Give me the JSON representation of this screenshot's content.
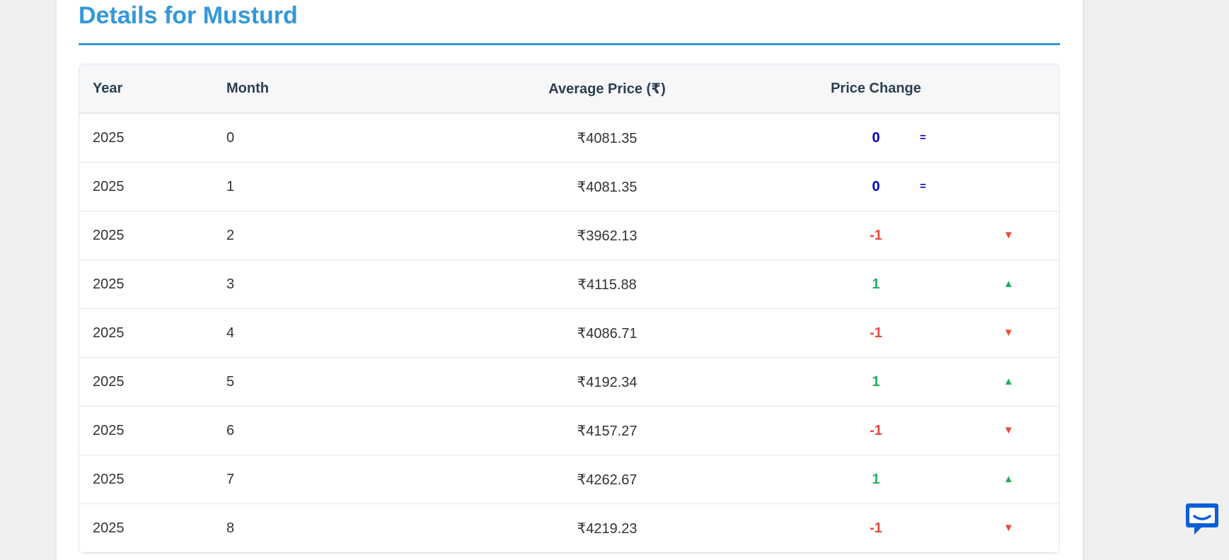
{
  "page": {
    "title": "Details for Musturd"
  },
  "table": {
    "headers": {
      "year": "Year",
      "month": "Month",
      "avg_price": "Average Price (₹)",
      "price_change": "Price Change"
    },
    "rows": [
      {
        "year": "2025",
        "month": "0",
        "price": "₹4081.35",
        "change": "0",
        "trend": "flat",
        "trend_icon": "="
      },
      {
        "year": "2025",
        "month": "1",
        "price": "₹4081.35",
        "change": "0",
        "trend": "flat",
        "trend_icon": "="
      },
      {
        "year": "2025",
        "month": "2",
        "price": "₹3962.13",
        "change": "-1",
        "trend": "down",
        "trend_icon": "▼"
      },
      {
        "year": "2025",
        "month": "3",
        "price": "₹4115.88",
        "change": "1",
        "trend": "up",
        "trend_icon": "▲"
      },
      {
        "year": "2025",
        "month": "4",
        "price": "₹4086.71",
        "change": "-1",
        "trend": "down",
        "trend_icon": "▼"
      },
      {
        "year": "2025",
        "month": "5",
        "price": "₹4192.34",
        "change": "1",
        "trend": "up",
        "trend_icon": "▲"
      },
      {
        "year": "2025",
        "month": "6",
        "price": "₹4157.27",
        "change": "-1",
        "trend": "down",
        "trend_icon": "▼"
      },
      {
        "year": "2025",
        "month": "7",
        "price": "₹4262.67",
        "change": "1",
        "trend": "up",
        "trend_icon": "▲"
      },
      {
        "year": "2025",
        "month": "8",
        "price": "₹4219.23",
        "change": "-1",
        "trend": "down",
        "trend_icon": "▼"
      }
    ]
  },
  "colors": {
    "accent": "#3498db",
    "up": "#27ae60",
    "down": "#e74c3c",
    "flat": "#0000cc",
    "chat": "#0a5fd8"
  },
  "chat_widget": {
    "icon": "chat-bubble-icon"
  }
}
